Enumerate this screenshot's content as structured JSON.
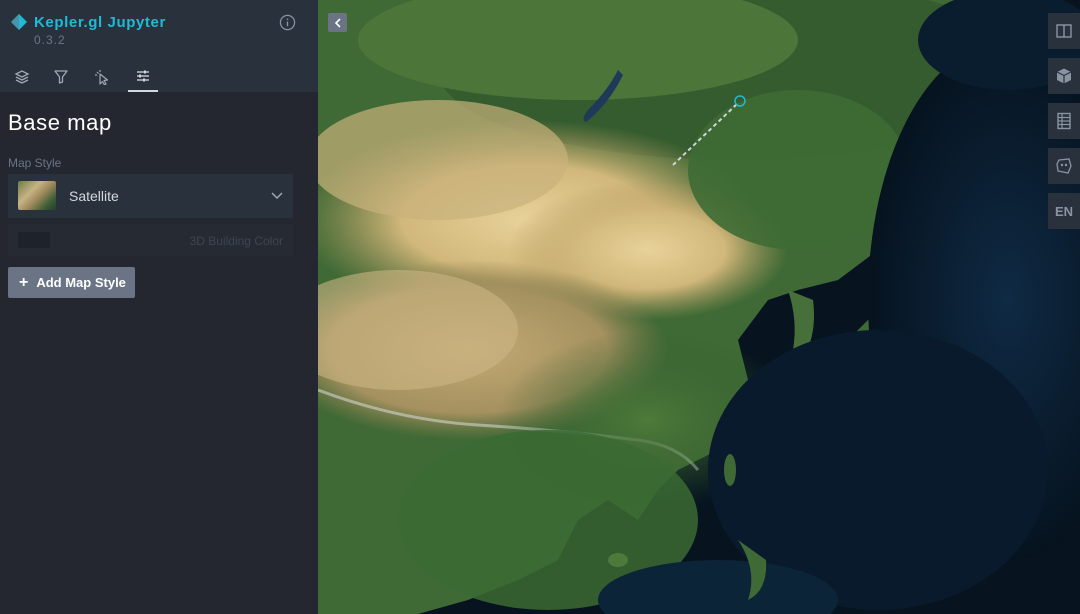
{
  "app": {
    "title": "Kepler.gl Jupyter",
    "version": "0.3.2",
    "accent_color": "#1fbad6"
  },
  "sidebar": {
    "tabs": [
      {
        "name": "layers",
        "icon": "layers-icon",
        "active": false
      },
      {
        "name": "filters",
        "icon": "filter-icon",
        "active": false
      },
      {
        "name": "interactions",
        "icon": "cursor-click-icon",
        "active": false
      },
      {
        "name": "base-map",
        "icon": "sliders-icon",
        "active": true
      }
    ],
    "panel_title": "Base map",
    "map_style_label": "Map Style",
    "selected_style": "Satellite",
    "building_color_label": "3D Building Color",
    "building_color": "#1d222b",
    "add_style_label": "Add Map Style"
  },
  "map_controls": {
    "items": [
      {
        "name": "split-map",
        "icon": "split-map-icon"
      },
      {
        "name": "3d-view",
        "icon": "cube-icon"
      },
      {
        "name": "legend",
        "icon": "legend-icon"
      },
      {
        "name": "draw",
        "icon": "polygon-draw-icon"
      },
      {
        "name": "locale",
        "label": "EN"
      }
    ]
  }
}
